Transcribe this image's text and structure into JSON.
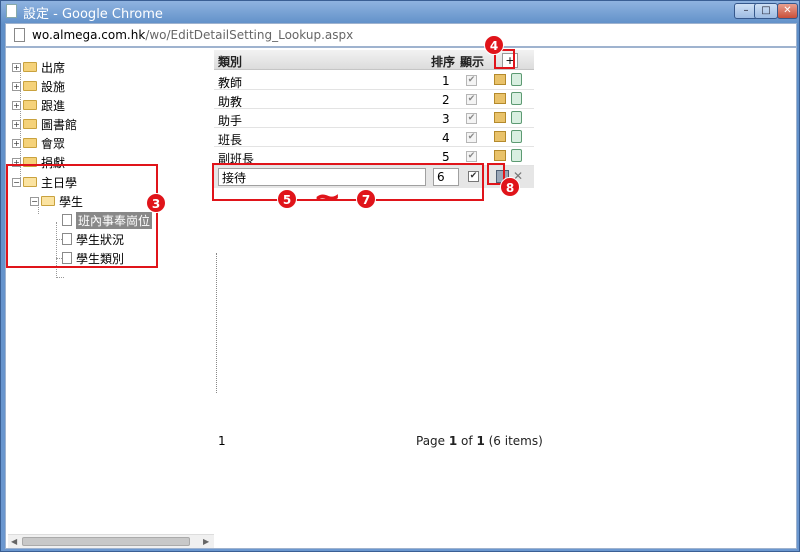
{
  "window": {
    "title": "設定 - Google Chrome",
    "min": "–",
    "max": "□",
    "close": "✕"
  },
  "address": {
    "host": "wo.almega.com.hk",
    "path": "/wo/EditDetailSetting_Lookup.aspx"
  },
  "tree": {
    "items": [
      {
        "label": "出席"
      },
      {
        "label": "設施"
      },
      {
        "label": "跟進"
      },
      {
        "label": "圖書館"
      },
      {
        "label": "會眾"
      },
      {
        "label": "捐獻"
      },
      {
        "label": "主日學"
      },
      {
        "label": "學生"
      },
      {
        "label": "班內事奉崗位"
      },
      {
        "label": "學生狀況"
      },
      {
        "label": "學生類別"
      }
    ]
  },
  "grid": {
    "headers": {
      "category": "類別",
      "order": "排序",
      "show": "顯示",
      "add": "+"
    },
    "rows": [
      {
        "category": "教師",
        "order": "1",
        "show": "✔"
      },
      {
        "category": "助教",
        "order": "2",
        "show": "✔"
      },
      {
        "category": "助手",
        "order": "3",
        "show": "✔"
      },
      {
        "category": "班長",
        "order": "4",
        "show": "✔"
      },
      {
        "category": "副班長",
        "order": "5",
        "show": "✔"
      }
    ],
    "edit_row": {
      "category": "接待",
      "order": "6",
      "show": "✔",
      "cancel": "✕"
    }
  },
  "pager": {
    "page_num": "1",
    "prefix": "Page ",
    "current": "1",
    "of": " of ",
    "total": "1",
    "suffix": " (6 items)"
  },
  "annotations": {
    "b3": "3",
    "b4": "4",
    "b5": "5",
    "tilde": "~",
    "b7": "7",
    "b8": "8"
  },
  "colors": {
    "accent": "#e0141a"
  }
}
